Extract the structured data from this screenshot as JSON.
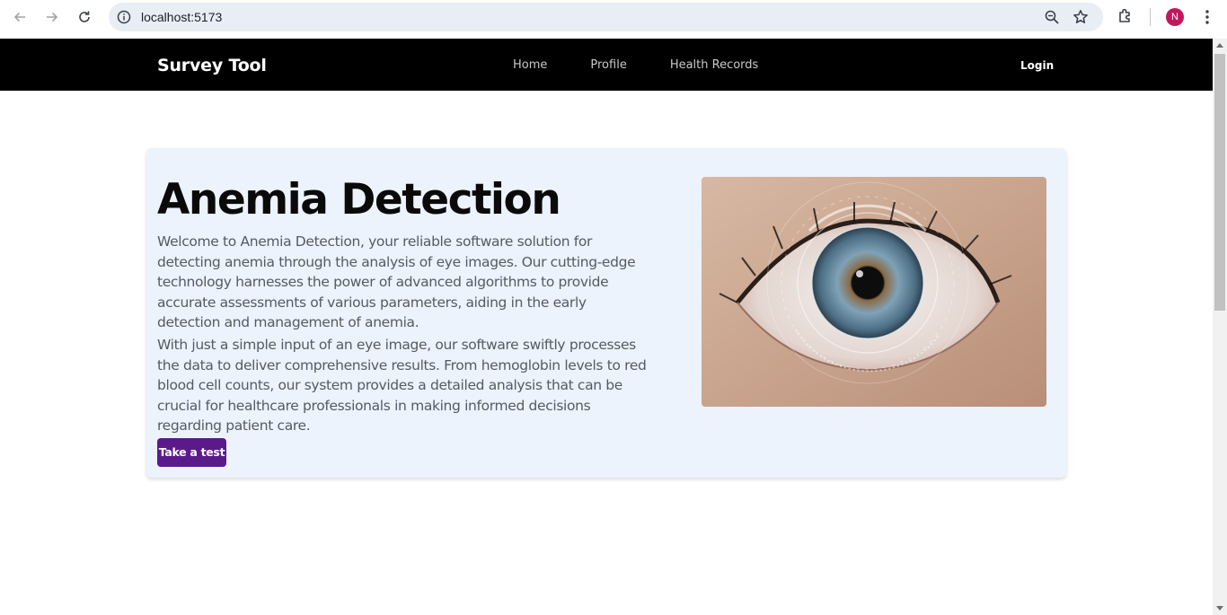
{
  "browser": {
    "url": "localhost:5173",
    "profile_initial": "N",
    "icons": {
      "back": "arrow-left-icon",
      "forward": "arrow-right-icon",
      "reload": "reload-icon",
      "site_info": "info-circle-icon",
      "zoom": "zoom-icon",
      "bookmark": "star-icon",
      "extensions": "puzzle-icon",
      "menu": "kebab-menu-icon"
    },
    "colors": {
      "profile_avatar": "#c2185b"
    }
  },
  "navbar": {
    "brand": "Survey Tool",
    "links": [
      "Home",
      "Profile",
      "Health Records"
    ],
    "login": "Login",
    "colors": {
      "background": "#000000"
    }
  },
  "hero": {
    "title": "Anemia Detection",
    "paragraph1": "Welcome to Anemia Detection, your reliable software solution for detecting anemia through the analysis of eye images. Our cutting-edge technology harnesses the power of advanced algorithms to provide accurate assessments of various parameters, aiding in the early detection and management of anemia.",
    "paragraph2": "With just a simple input of an eye image, our software swiftly processes the data to deliver comprehensive results. From hemoglobin levels to red blood cell counts, our system provides a detailed analysis that can be crucial for healthcare professionals in making informed decisions regarding patient care.",
    "cta_label": "Take a test",
    "image": "eye-scan-image",
    "colors": {
      "card_background": "#ecf3fd",
      "cta_background": "#5b1a8a"
    }
  }
}
